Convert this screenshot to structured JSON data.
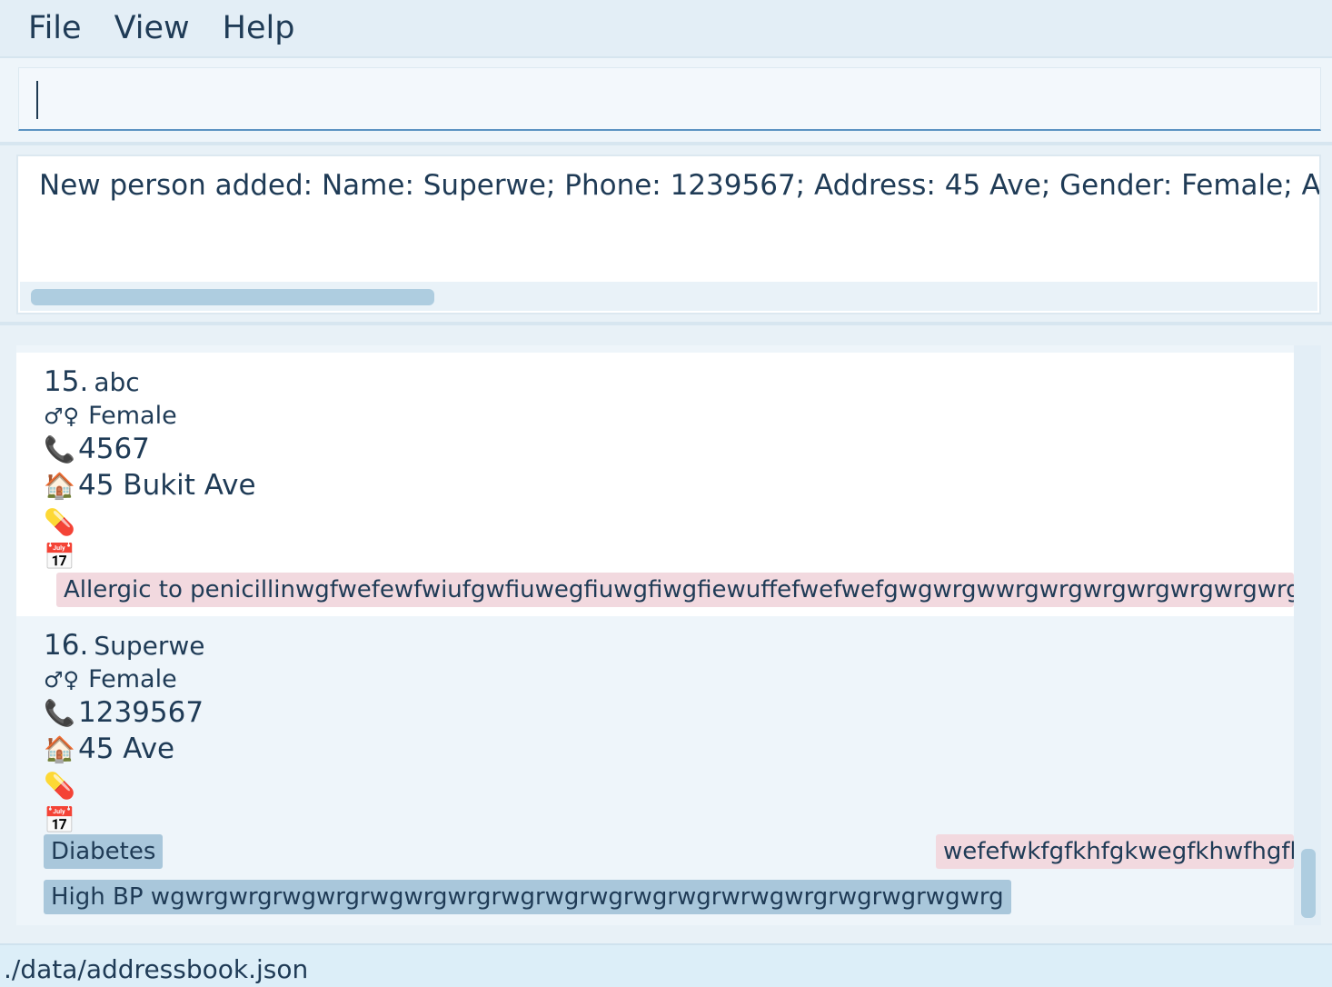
{
  "menu": {
    "file": "File",
    "view": "View",
    "help": "Help"
  },
  "command": {
    "value": "",
    "placeholder": ""
  },
  "result": {
    "message": "New person added: Name: Superwe; Phone: 1239567; Address: 45 Ave; Gender: Female; Appoint"
  },
  "persons": [
    {
      "index": "15.",
      "name": "abc",
      "gender_icon": "♂♀",
      "gender": "Female",
      "phone": "4567",
      "address": "45 Bukit Ave",
      "allergies": [
        "Allergic to penicillinwgfwefewfwiufgwfiuwegfiuwgfiwgfiewuffefwefwefgwgwrgwwrgwrgwrgwrgwrgwrgwrgwrgwrggw"
      ],
      "conditions": []
    },
    {
      "index": "16.",
      "name": "Superwe",
      "gender_icon": "♂♀",
      "gender": "Female",
      "phone": "1239567",
      "address": "45 Ave",
      "allergies": [
        "wefefwkfgfkhfgkwegfkhwfhgfkhf"
      ],
      "conditions": [
        "Diabetes",
        "High BP wgwrgwrgrwgwrgrwgwrgwrgrwgrwgrwgrwgrwgrwrwgwrgrwgrwgrwgwrg"
      ]
    }
  ],
  "icons": {
    "phone": "📞",
    "address": "🏠",
    "medication": "💊",
    "appointment": "📅"
  },
  "status": {
    "path": "./data/addressbook.json"
  },
  "colors": {
    "accent": "#5b93c2",
    "allergy_tag": "#f2d9df",
    "condition_tag": "#a9c7db",
    "menubar": "#e3eef6"
  }
}
